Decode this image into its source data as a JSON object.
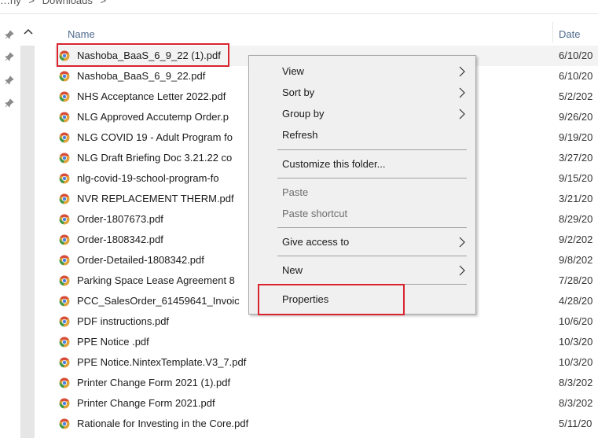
{
  "breadcrumb": {
    "parent": "…ny",
    "separator": ">",
    "current": "Downloads",
    "trailing": ">"
  },
  "file_list": {
    "columns": {
      "name": "Name",
      "date": "Date"
    },
    "rows": [
      {
        "name": "Nashoba_BaaS_6_9_22 (1).pdf",
        "date": "6/10/20"
      },
      {
        "name": "Nashoba_BaaS_6_9_22.pdf",
        "date": "6/10/20"
      },
      {
        "name": "NHS Acceptance Letter 2022.pdf",
        "date": "5/2/202"
      },
      {
        "name": "NLG Approved Accutemp Order.p",
        "date": "9/26/20"
      },
      {
        "name": "NLG COVID 19 - Adult Program fo",
        "date": "9/19/20"
      },
      {
        "name": "NLG Draft Briefing Doc 3.21.22 co",
        "date": "3/27/20"
      },
      {
        "name": "nlg-covid-19-school-program-fo",
        "date": "9/15/20"
      },
      {
        "name": "NVR REPLACEMENT THERM.pdf",
        "date": "3/21/20"
      },
      {
        "name": "Order-1807673.pdf",
        "date": "8/29/20"
      },
      {
        "name": "Order-1808342.pdf",
        "date": "9/2/202"
      },
      {
        "name": "Order-Detailed-1808342.pdf",
        "date": "9/8/202"
      },
      {
        "name": "Parking Space Lease Agreement 8",
        "date": "7/28/20"
      },
      {
        "name": "PCC_SalesOrder_61459641_Invoic",
        "date": "4/28/20"
      },
      {
        "name": "PDF instructions.pdf",
        "date": "10/6/20"
      },
      {
        "name": "PPE Notice .pdf",
        "date": "10/3/20"
      },
      {
        "name": "PPE Notice.NintexTemplate.V3_7.pdf",
        "date": "10/3/20"
      },
      {
        "name": "Printer Change Form 2021 (1).pdf",
        "date": "8/3/202"
      },
      {
        "name": "Printer Change Form 2021.pdf",
        "date": "8/3/202"
      },
      {
        "name": "Rationale for Investing in the Core.pdf",
        "date": "5/11/20"
      }
    ]
  },
  "context_menu": {
    "view": "View",
    "sort_by": "Sort by",
    "group_by": "Group by",
    "refresh": "Refresh",
    "customize": "Customize this folder...",
    "paste": "Paste",
    "paste_shortcut": "Paste shortcut",
    "give_access": "Give access to",
    "new": "New",
    "properties": "Properties"
  },
  "colors": {
    "highlight_box": "#d9232e",
    "header_text": "#4d6a8c",
    "menu_bg": "#f0f0f0"
  },
  "icons": {
    "file": "chrome-pdf-icon",
    "pin": "pin-icon",
    "submenu": "chevron-right-icon",
    "collapse": "chevron-up-icon"
  }
}
